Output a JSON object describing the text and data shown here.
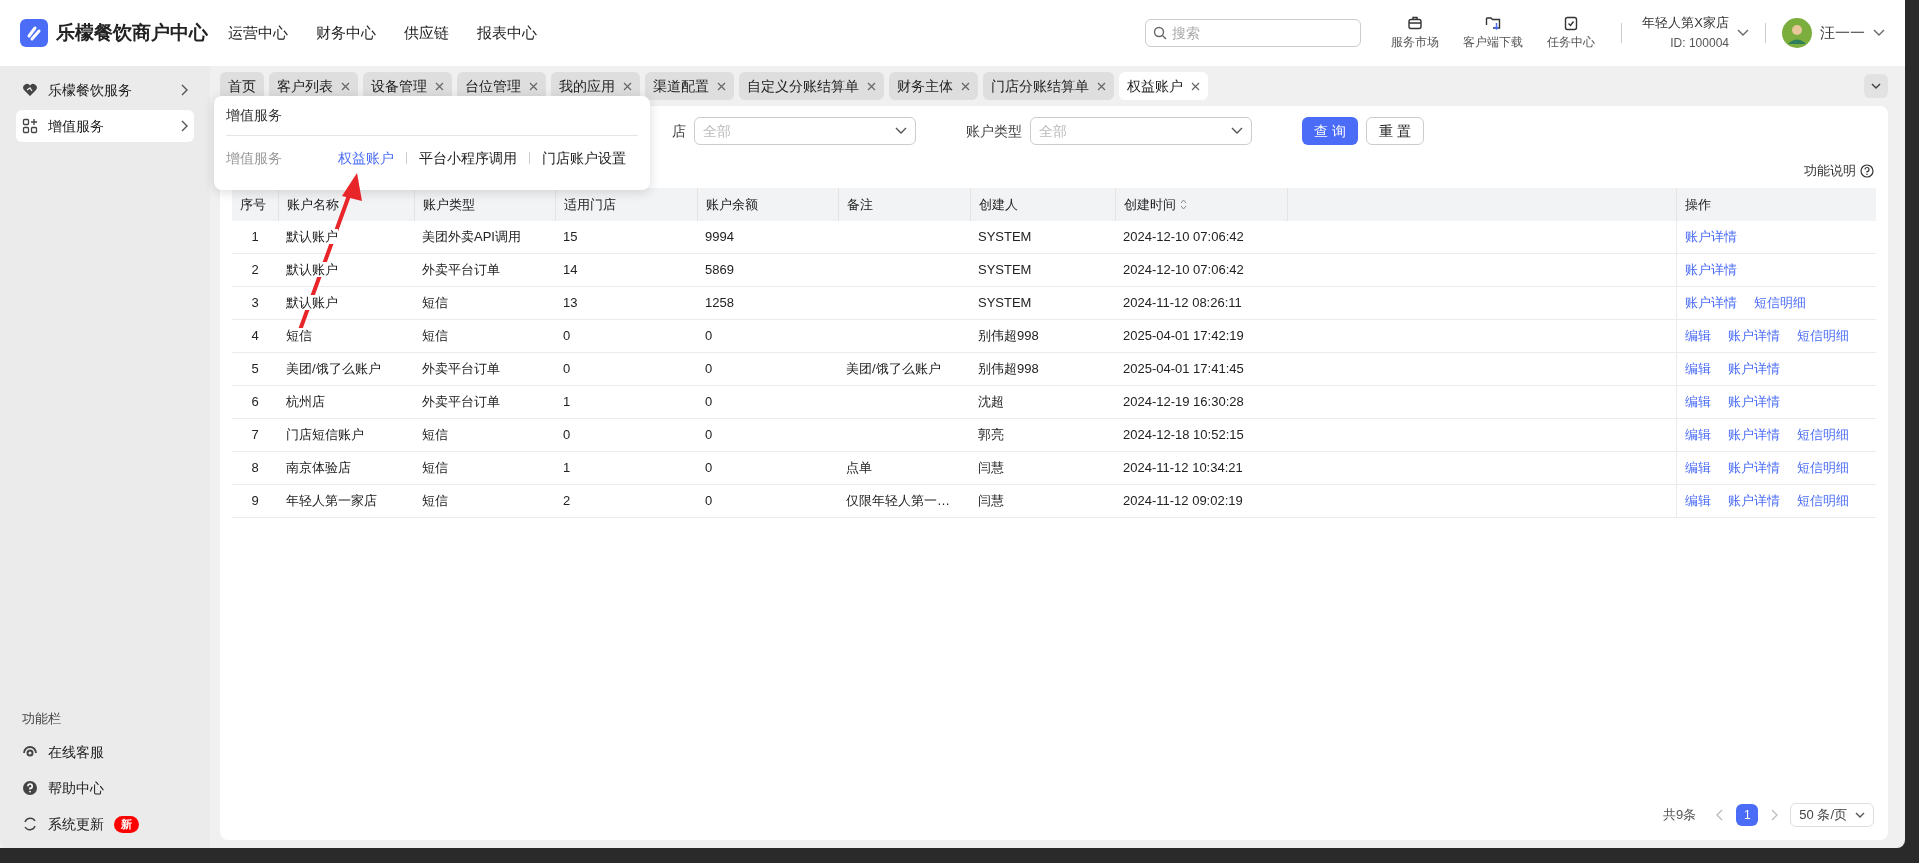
{
  "app": {
    "title": "乐檬餐饮商户中心"
  },
  "top_nav": [
    "运营中心",
    "财务中心",
    "供应链",
    "报表中心"
  ],
  "search": {
    "placeholder": "搜索"
  },
  "toolbar": [
    {
      "kind": "market",
      "label": "服务市场"
    },
    {
      "kind": "download",
      "label": "客户端下载"
    },
    {
      "kind": "task",
      "label": "任务中心"
    }
  ],
  "store": {
    "name": "年轻人第X家店",
    "id": "ID: 100004"
  },
  "user": {
    "name": "汪一一"
  },
  "sidebar": {
    "items": [
      {
        "kind": "heart",
        "label": "乐檬餐饮服务",
        "selected": false
      },
      {
        "kind": "grid",
        "label": "增值服务",
        "selected": true
      }
    ],
    "footer_title": "功能栏",
    "footer_items": [
      {
        "kind": "support",
        "label": "在线客服"
      },
      {
        "kind": "help",
        "label": "帮助中心"
      },
      {
        "kind": "update",
        "label": "系统更新",
        "badge": "新"
      }
    ]
  },
  "tabs": [
    {
      "label": "首页",
      "closable": false,
      "selected": false
    },
    {
      "label": "客户列表",
      "closable": true,
      "selected": false
    },
    {
      "label": "设备管理",
      "closable": true,
      "selected": false
    },
    {
      "label": "台位管理",
      "closable": true,
      "selected": false
    },
    {
      "label": "我的应用",
      "closable": true,
      "selected": false
    },
    {
      "label": "渠道配置",
      "closable": true,
      "selected": false
    },
    {
      "label": "自定义分账结算单",
      "closable": true,
      "selected": false
    },
    {
      "label": "财务主体",
      "closable": true,
      "selected": false
    },
    {
      "label": "门店分账结算单",
      "closable": true,
      "selected": false
    },
    {
      "label": "权益账户",
      "closable": true,
      "selected": true
    }
  ],
  "popup": {
    "title": "增值服务",
    "group": "增值服务",
    "links": [
      {
        "label": "权益账户",
        "selected": true
      },
      {
        "label": "平台小程序调用",
        "selected": false
      },
      {
        "label": "门店账户设置",
        "selected": false
      }
    ]
  },
  "filters": [
    {
      "label": "店",
      "value": "全部"
    },
    {
      "label": "账户类型",
      "value": "全部"
    }
  ],
  "buttons": [
    {
      "label": "查 询",
      "primary": true
    },
    {
      "label": "重 置",
      "primary": false
    }
  ],
  "help_link": "功能说明",
  "table": {
    "columns": [
      "序号",
      "账户名称",
      "账户类型",
      "适用门店",
      "账户余额",
      "备注",
      "创建人",
      "创建时间",
      "操作"
    ],
    "rows": [
      {
        "cells": [
          "1",
          "默认账户",
          "美团外卖API调用",
          "15",
          "9994",
          "",
          "SYSTEM",
          "2024-12-10 07:06:42"
        ],
        "actions": [
          "账户详情"
        ]
      },
      {
        "cells": [
          "2",
          "默认账户",
          "外卖平台订单",
          "14",
          "5869",
          "",
          "SYSTEM",
          "2024-12-10 07:06:42"
        ],
        "actions": [
          "账户详情"
        ]
      },
      {
        "cells": [
          "3",
          "默认账户",
          "短信",
          "13",
          "1258",
          "",
          "SYSTEM",
          "2024-11-12 08:26:11"
        ],
        "actions": [
          "账户详情",
          "短信明细"
        ]
      },
      {
        "cells": [
          "4",
          "短信",
          "短信",
          "0",
          "0",
          "",
          "别伟超998",
          "2025-04-01 17:42:19"
        ],
        "actions": [
          "编辑",
          "账户详情",
          "短信明细"
        ]
      },
      {
        "cells": [
          "5",
          "美团/饿了么账户",
          "外卖平台订单",
          "0",
          "0",
          "美团/饿了么账户",
          "别伟超998",
          "2025-04-01 17:41:45"
        ],
        "actions": [
          "编辑",
          "账户详情"
        ]
      },
      {
        "cells": [
          "6",
          "杭州店",
          "外卖平台订单",
          "1",
          "0",
          "",
          "沈超",
          "2024-12-19 16:30:28"
        ],
        "actions": [
          "编辑",
          "账户详情"
        ]
      },
      {
        "cells": [
          "7",
          "门店短信账户",
          "短信",
          "0",
          "0",
          "",
          "郭亮",
          "2024-12-18 10:52:15"
        ],
        "actions": [
          "编辑",
          "账户详情",
          "短信明细"
        ]
      },
      {
        "cells": [
          "8",
          "南京体验店",
          "短信",
          "1",
          "0",
          "点单",
          "闫慧",
          "2024-11-12 10:34:21"
        ],
        "actions": [
          "编辑",
          "账户详情",
          "短信明细"
        ]
      },
      {
        "cells": [
          "9",
          "年轻人第一家店",
          "短信",
          "2",
          "0",
          "仅限年轻人第一…",
          "闫慧",
          "2024-11-12 09:02:19"
        ],
        "actions": [
          "编辑",
          "账户详情",
          "短信明细"
        ]
      }
    ]
  },
  "pagination": {
    "total": "共9条",
    "pages": [
      {
        "label": "1",
        "selected": true
      }
    ],
    "page_size": "50 条/页"
  }
}
